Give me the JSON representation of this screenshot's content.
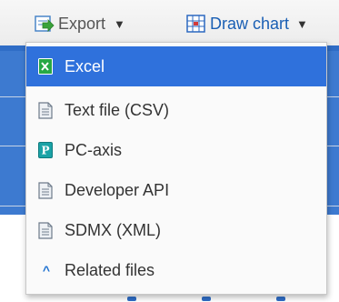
{
  "toolbar": {
    "export_label": "Export",
    "draw_chart_label": "Draw chart"
  },
  "menu": {
    "items": [
      {
        "label": "Excel",
        "icon": "excel-icon",
        "selected": true
      },
      {
        "label": "Text file (CSV)",
        "icon": "document-icon"
      },
      {
        "label": "PC-axis",
        "icon": "pc-axis-icon"
      },
      {
        "label": "Developer API",
        "icon": "document-icon"
      },
      {
        "label": "SDMX (XML)",
        "icon": "document-icon"
      },
      {
        "label": "Related files",
        "icon": "chevron-up-icon"
      }
    ]
  },
  "colors": {
    "selected_bg": "#2f71dc",
    "link_blue": "#1a5fb4",
    "header_blue": "#2f6dc6"
  }
}
